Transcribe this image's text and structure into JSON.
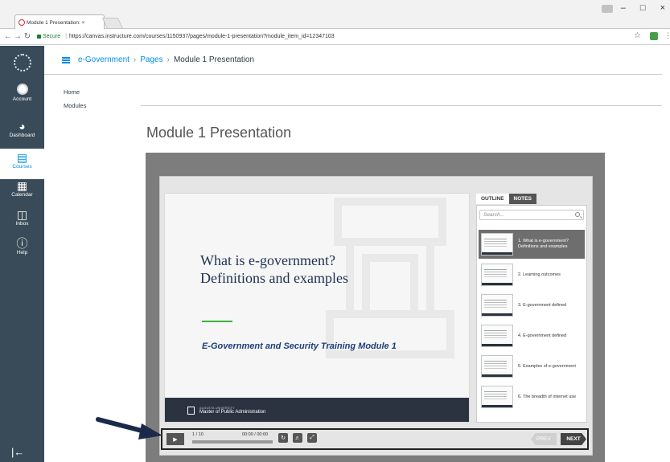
{
  "browser": {
    "tab_title": "Module 1 Presentation: ×",
    "tab_close": "×",
    "secure_label": "Secure",
    "url": "https://canvas.instructure.com/courses/1150937/pages/module-1-presentation?module_item_id=12347103",
    "window_controls": [
      "–",
      "□",
      "×"
    ]
  },
  "global_nav": {
    "items": [
      {
        "label": "Account",
        "icon": "account-avatar-icon"
      },
      {
        "label": "Dashboard",
        "icon": "dashboard-gauge-icon"
      },
      {
        "label": "Courses",
        "icon": "book-icon",
        "active": true
      },
      {
        "label": "Calendar",
        "icon": "calendar-icon"
      },
      {
        "label": "Inbox",
        "icon": "inbox-icon"
      },
      {
        "label": "Help",
        "icon": "help-circle-icon"
      }
    ],
    "collapse_icon": "collapse-arrow-icon"
  },
  "breadcrumb": {
    "course": "e-Government",
    "section": "Pages",
    "current": "Module 1 Presentation",
    "separator": "›"
  },
  "course_nav": {
    "items": [
      "Home",
      "Modules"
    ]
  },
  "page": {
    "title": "Module 1 Presentation"
  },
  "slide": {
    "title_line1": "What is e-government?",
    "title_line2": "Definitions and examples",
    "subtitle": "E-Government and Security Training Module 1",
    "footer_small": "AUGUSTA UNIVERSITY",
    "footer_main": "Master of Public Administration"
  },
  "outline": {
    "tab_outline": "OUTLINE",
    "tab_notes": "NOTES",
    "search_placeholder": "Search...",
    "items": [
      {
        "label": "1. What is e-government? Definitions and examples",
        "selected": true
      },
      {
        "label": "2. Learning outcomes"
      },
      {
        "label": "3. E-government defined"
      },
      {
        "label": "4. E-government defined"
      },
      {
        "label": "5. Examples of e-government"
      },
      {
        "label": "6. The breadth of internet use"
      }
    ]
  },
  "controls": {
    "slide_count": "1 / 10",
    "time": "00:00 / 00:00",
    "progress": 0.0,
    "prev_label": "PREV",
    "next_label": "NEXT"
  },
  "colors": {
    "canvas_nav": "#394b58",
    "canvas_link": "#008ee2",
    "annotation_arrow": "#1b2a4a"
  }
}
